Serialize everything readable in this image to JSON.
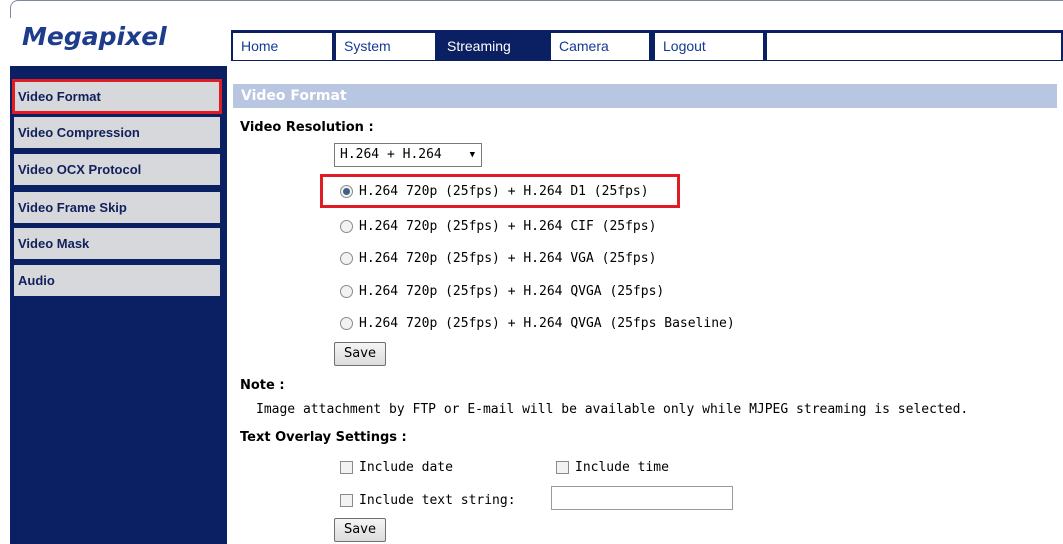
{
  "logo": "Megapixel",
  "nav": {
    "home": "Home",
    "system": "System",
    "streaming": "Streaming",
    "camera": "Camera",
    "logout": "Logout"
  },
  "sidebar": {
    "items": [
      {
        "label": "Video Format"
      },
      {
        "label": "Video Compression"
      },
      {
        "label": "Video OCX Protocol"
      },
      {
        "label": "Video Frame Skip"
      },
      {
        "label": "Video Mask"
      },
      {
        "label": "Audio"
      }
    ],
    "selected": "Video Format"
  },
  "main": {
    "section_title": "Video Format",
    "resolution_label": "Video Resolution :",
    "resolution_select": "H.264 + H.264",
    "options": [
      {
        "label": "H.264 720p (25fps) + H.264 D1 (25fps)",
        "checked": true
      },
      {
        "label": "H.264 720p (25fps) + H.264 CIF (25fps)",
        "checked": false
      },
      {
        "label": "H.264 720p (25fps) + H.264 VGA (25fps)",
        "checked": false
      },
      {
        "label": "H.264 720p (25fps) + H.264 QVGA (25fps)",
        "checked": false
      },
      {
        "label": "H.264 720p (25fps) + H.264 QVGA (25fps Baseline)",
        "checked": false
      }
    ],
    "save_label": "Save",
    "note_label": "Note :",
    "note_text": "Image attachment by FTP or E-mail will be available only while MJPEG streaming is selected.",
    "overlay_label": "Text Overlay Settings :",
    "include_date": "Include date",
    "include_time": "Include time",
    "include_text": "Include text string:",
    "text_value": "",
    "save2_label": "Save"
  },
  "colors": {
    "nav_bg": "#0b1f63",
    "section_header_bg": "#b9c6e2",
    "highlight": "#e01b24",
    "sidebar_item_bg": "#d6d8dc"
  }
}
